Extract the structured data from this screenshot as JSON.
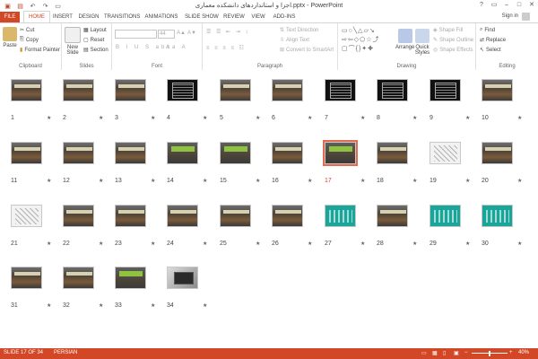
{
  "title": {
    "doc": "اجزا و استانداردهای دانشکده معماری.pptx - PowerPoint"
  },
  "tabs": {
    "file": "FILE",
    "home": "HOME",
    "insert": "INSERT",
    "design": "DESIGN",
    "transitions": "TRANSITIONS",
    "animations": "ANIMATIONS",
    "slideshow": "SLIDE SHOW",
    "review": "REVIEW",
    "view": "VIEW",
    "addins": "ADD-INS"
  },
  "signin": "Sign in",
  "ribbon": {
    "clipboard": {
      "paste": "Paste",
      "cut": "Cut",
      "copy": "Copy",
      "format_painter": "Format Painter",
      "label": "Clipboard"
    },
    "slides": {
      "new_slide": "New Slide",
      "layout": "Layout",
      "reset": "Reset",
      "section": "Section",
      "label": "Slides"
    },
    "font": {
      "size": "44",
      "label": "Font"
    },
    "paragraph": {
      "text_direction": "Text Direction",
      "align_text": "Align Text",
      "convert": "Convert to SmartArt",
      "label": "Paragraph"
    },
    "drawing": {
      "arrange": "Arrange",
      "quick_styles": "Quick Styles",
      "shape_fill": "Shape Fill",
      "shape_outline": "Shape Outline",
      "shape_effects": "Shape Effects",
      "label": "Drawing"
    },
    "editing": {
      "find": "Find",
      "replace": "Replace",
      "select": "Select",
      "label": "Editing"
    }
  },
  "slides": [
    {
      "n": "1",
      "style": "photo"
    },
    {
      "n": "2",
      "style": "photo"
    },
    {
      "n": "3",
      "style": "photo"
    },
    {
      "n": "4",
      "style": "dark"
    },
    {
      "n": "5",
      "style": "photo"
    },
    {
      "n": "6",
      "style": "photo"
    },
    {
      "n": "7",
      "style": "dark"
    },
    {
      "n": "8",
      "style": "dark"
    },
    {
      "n": "9",
      "style": "dark"
    },
    {
      "n": "10",
      "style": "photo"
    },
    {
      "n": "11",
      "style": "photo"
    },
    {
      "n": "12",
      "style": "photo"
    },
    {
      "n": "13",
      "style": "photo"
    },
    {
      "n": "14",
      "style": "green"
    },
    {
      "n": "15",
      "style": "green"
    },
    {
      "n": "16",
      "style": "photo"
    },
    {
      "n": "17",
      "style": "green",
      "selected": true
    },
    {
      "n": "18",
      "style": "photo"
    },
    {
      "n": "19",
      "style": "sketch"
    },
    {
      "n": "20",
      "style": "photo"
    },
    {
      "n": "21",
      "style": "sketch"
    },
    {
      "n": "22",
      "style": "photo"
    },
    {
      "n": "23",
      "style": "photo"
    },
    {
      "n": "24",
      "style": "photo"
    },
    {
      "n": "25",
      "style": "photo"
    },
    {
      "n": "26",
      "style": "photo"
    },
    {
      "n": "27",
      "style": "teal"
    },
    {
      "n": "28",
      "style": "photo"
    },
    {
      "n": "29",
      "style": "teal"
    },
    {
      "n": "30",
      "style": "teal"
    },
    {
      "n": "31",
      "style": "photo"
    },
    {
      "n": "32",
      "style": "photo"
    },
    {
      "n": "33",
      "style": "green"
    },
    {
      "n": "34",
      "style": "laptop"
    }
  ],
  "star": "★",
  "status": {
    "slide": "SLIDE 17 OF 34",
    "language": "PERSIAN",
    "zoom": "40%",
    "minus": "−",
    "plus": "+"
  },
  "colors": {
    "accent": "#d24726",
    "selected_border": "#e46a4f"
  }
}
